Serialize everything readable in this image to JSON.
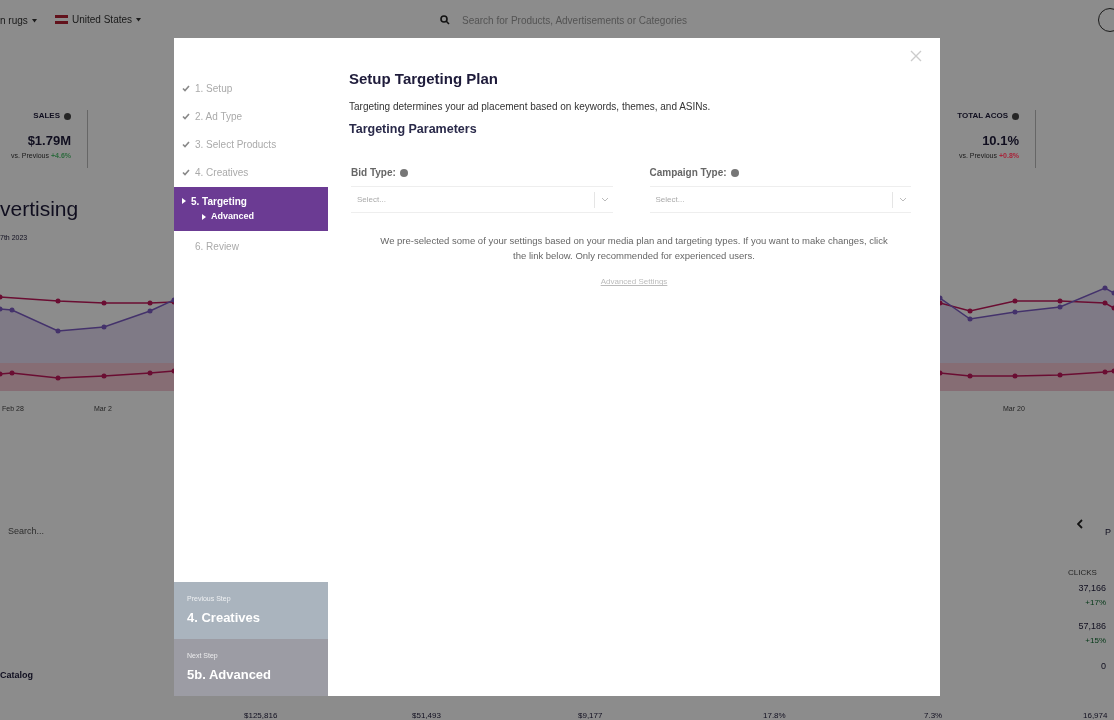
{
  "top_bar": {
    "store": "n rugs",
    "country": "United States",
    "search_placeholder": "Search for Products, Advertisements or Categories"
  },
  "metrics": [
    {
      "label": "SALES",
      "value": "$1.79M",
      "comparison": "vs. Previous",
      "change": "+4.6%",
      "color": "#2e6b3f"
    },
    {
      "label": "TOTAL ACOS",
      "value": "10.1%",
      "comparison": "vs. Previous",
      "change": "+0.8%",
      "color": "#a8243a"
    }
  ],
  "page_title": "vertising",
  "date": "7th 2023",
  "chart_axis": {
    "left": [
      "Feb 28",
      "Mar 2"
    ],
    "right": [
      "Mar 20"
    ]
  },
  "table": {
    "search_placeholder": "Search...",
    "pager": "P",
    "column_header": "CLICKS",
    "catalog_label": "Catalog",
    "rows": [
      {
        "value": "37,166",
        "change": "+17%"
      },
      {
        "value": "57,186",
        "change": "+15%"
      },
      {
        "value": "0"
      }
    ],
    "totals": [
      "$125,816",
      "$51,493",
      "$9,177",
      "17.8%",
      "7.3%",
      "16,974"
    ]
  },
  "modal": {
    "title": "Setup Targeting Plan",
    "description": "Targeting determines your ad placement based on keywords, themes, and ASINs.",
    "section": "Targeting Parameters",
    "fields": [
      {
        "label": "Bid Type:",
        "placeholder": "Select..."
      },
      {
        "label": "Campaign Type:",
        "placeholder": "Select..."
      }
    ],
    "note": "We pre-selected some of your settings based on your media plan and targeting types. If you want to make changes, click the link below. Only recommended for experienced users.",
    "link": "Advanced Settings",
    "steps": [
      {
        "label": "1. Setup",
        "done": true,
        "selected": false
      },
      {
        "label": "2. Ad Type",
        "done": true,
        "selected": false
      },
      {
        "label": "3. Select Products",
        "done": true,
        "selected": false
      },
      {
        "label": "4. Creatives",
        "done": true,
        "selected": false
      },
      {
        "label": "5. Targeting",
        "done": false,
        "selected": true,
        "children": [
          {
            "label": "Advanced",
            "selected": true
          }
        ]
      },
      {
        "label": "6. Review",
        "done": false,
        "selected": false
      }
    ],
    "previous_step": {
      "caption": "Previous Step",
      "title": "4. Creatives"
    },
    "next_step": {
      "caption": "Next Step",
      "title": "5b. Advanced"
    }
  }
}
